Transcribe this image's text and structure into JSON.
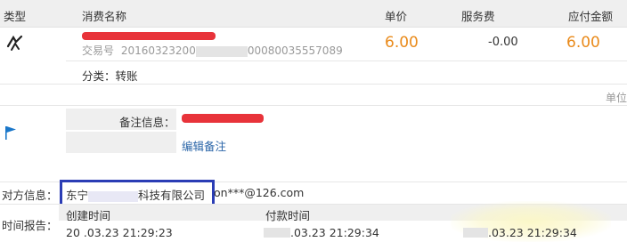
{
  "header": {
    "type": "类型",
    "name": "消费名称",
    "unit_price": "单价",
    "service_fee": "服务费",
    "amount_due": "应付金额"
  },
  "transaction": {
    "icon": "transfer-icon",
    "trade_no_label": "交易号",
    "trade_no_visible_a": "20160323200",
    "trade_no_visible_b": "00080035557089",
    "unit_price": "6.00",
    "service_fee": "-0.00",
    "amount_due": "6.00",
    "category": "分类：转账"
  },
  "unit_label": "单位",
  "memo": {
    "icon": "flag-icon",
    "label": "备注信息：",
    "edit_link": "编辑备注"
  },
  "counterparty": {
    "label": "对方信息：",
    "company_prefix": "东宁",
    "company_suffix": "科技有限公司",
    "email": "on***@126.com"
  },
  "time_report": {
    "label": "时间报告：",
    "created_label": "创建时间",
    "paid_label": "付款时间",
    "created_value": "20 .03.23 21:29:23",
    "paid_value": ".03.23 21:29:34",
    "third_value": ".03.23 21:29:34"
  },
  "colors": {
    "price": "#e98a1a",
    "highlight_box": "#2b3db5",
    "redaction": "#e8333a",
    "link": "#2a65a8"
  }
}
